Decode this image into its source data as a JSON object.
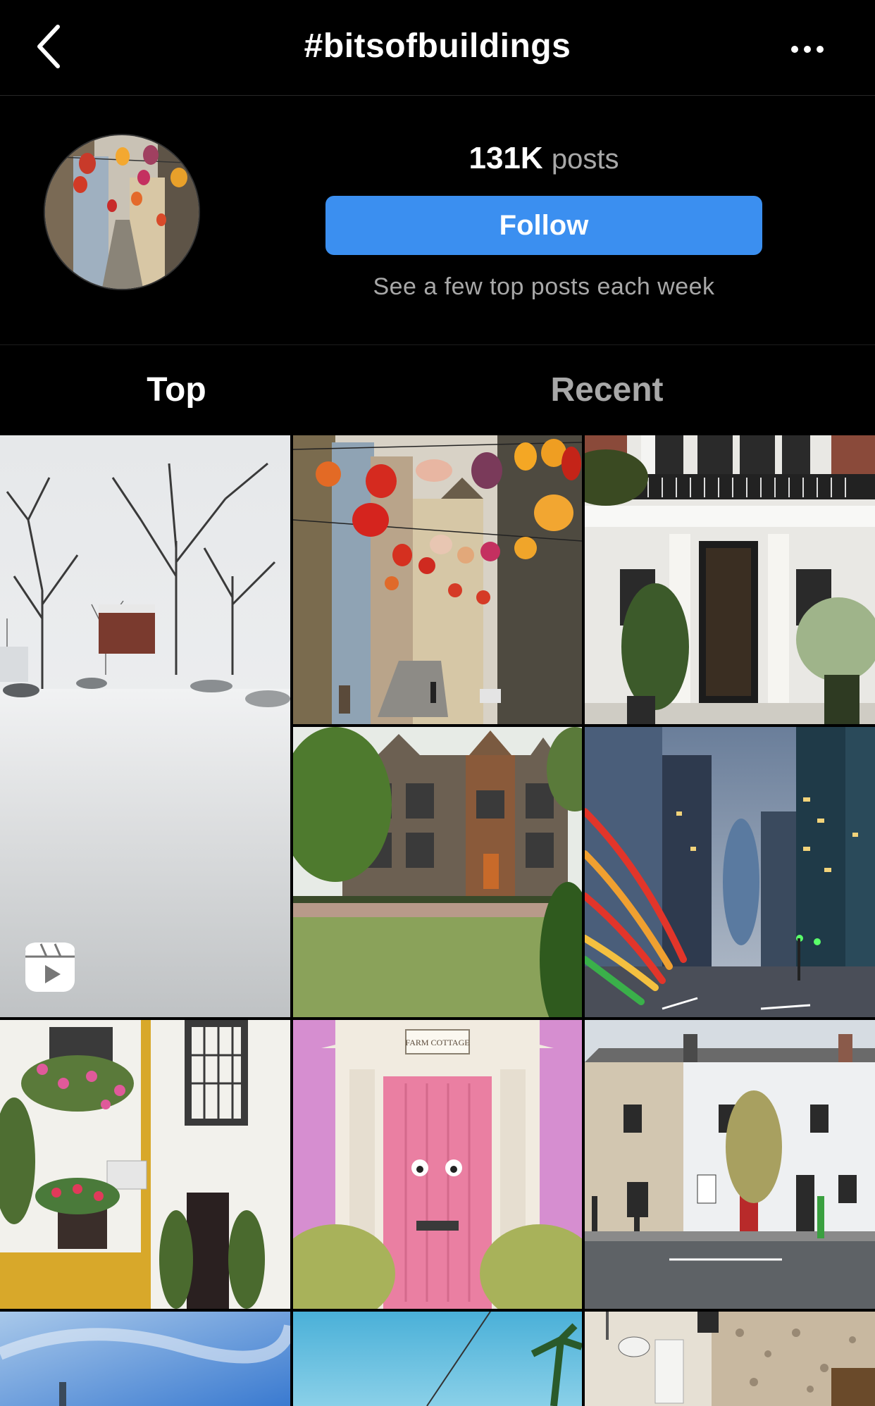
{
  "header": {
    "back_icon": "chevron-left-icon",
    "title": "#bitsofbuildings",
    "more_icon": "more-horizontal-icon"
  },
  "profile": {
    "post_count": "131K",
    "post_label": "posts",
    "follow_label": "Follow",
    "subtext": "See a few top posts each week",
    "follow_color": "#3b8ff0"
  },
  "tabs": [
    {
      "label": "Top",
      "active": true
    },
    {
      "label": "Recent",
      "active": false
    }
  ],
  "grid": {
    "tiles": [
      {
        "subject": "snowy park",
        "reel": true,
        "reel_icon": "reels-icon"
      },
      {
        "subject": "street with hanging lanterns"
      },
      {
        "subject": "white townhouse with black door"
      },
      {
        "subject": "gothic stone manor"
      },
      {
        "subject": "city street at dusk with light trails"
      },
      {
        "subject": "white facade with flower balconies"
      },
      {
        "subject": "pink door farm cottage",
        "sign": "FARM COTTAGE"
      },
      {
        "subject": "terraced houses on street corner"
      },
      {
        "subject": "blue sky with bird"
      },
      {
        "subject": "blue sky with palm"
      },
      {
        "subject": "ornate interior with lamps"
      }
    ]
  }
}
